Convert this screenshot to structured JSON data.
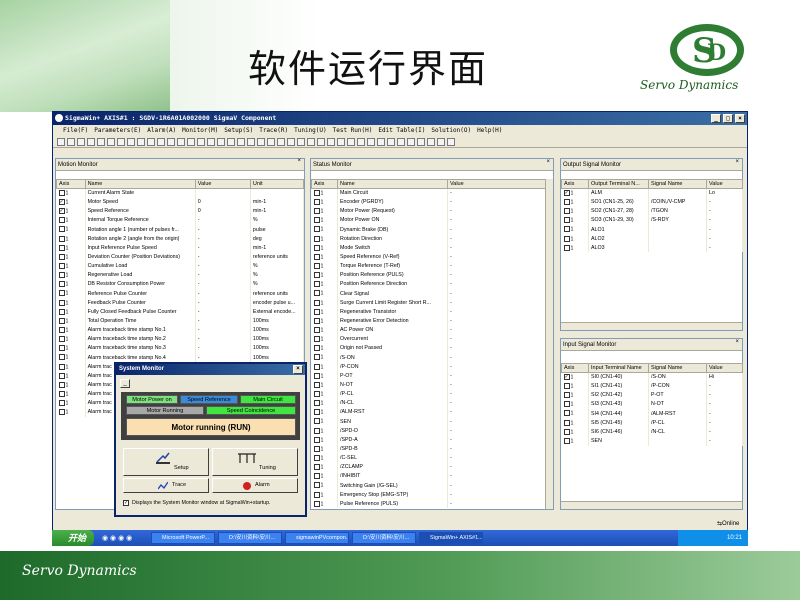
{
  "slide": {
    "title": "软件运行界面",
    "logo_text": "Servo Dynamics",
    "footer_text": "Servo Dynamics",
    "brand_color": "#1d6a2a"
  },
  "window": {
    "title": "SigmaWin+ AXIS#1 : SGDV-1R6A01A002000 SigmaV Component"
  },
  "menu": [
    "File(F)",
    "Parameters(E)",
    "Alarm(A)",
    "Monitor(M)",
    "Setup(S)",
    "Trace(R)",
    "Tuning(U)",
    "Test Run(H)",
    "Edit Table(I)",
    "Solution(O)",
    "Help(H)"
  ],
  "motion_monitor": {
    "title": "Motion Monitor",
    "headers": [
      "Axis",
      "Name",
      "Value",
      "Unit"
    ],
    "rows": [
      {
        "axis": "1",
        "checked": false,
        "name": "Current Alarm State",
        "value": "",
        "unit": ""
      },
      {
        "axis": "1",
        "checked": true,
        "name": "Motor Speed",
        "value": "0",
        "unit": "min-1"
      },
      {
        "axis": "1",
        "checked": true,
        "name": "Speed Reference",
        "value": "0",
        "unit": "min-1"
      },
      {
        "axis": "1",
        "checked": false,
        "name": "Internal Torque Reference",
        "value": "-",
        "unit": "%"
      },
      {
        "axis": "1",
        "checked": false,
        "name": "Rotation angle 1 (number of pulses fr...",
        "value": "-",
        "unit": "pulse"
      },
      {
        "axis": "1",
        "checked": false,
        "name": "Rotation angle 2 (angle from the origin)",
        "value": "-",
        "unit": "deg"
      },
      {
        "axis": "1",
        "checked": false,
        "name": "Input Reference Pulse Speed",
        "value": "-",
        "unit": "min-1"
      },
      {
        "axis": "1",
        "checked": false,
        "name": "Deviation Counter (Position Deviations)",
        "value": "-",
        "unit": "reference units"
      },
      {
        "axis": "1",
        "checked": false,
        "name": "Cumulative Load",
        "value": "-",
        "unit": "%"
      },
      {
        "axis": "1",
        "checked": false,
        "name": "Regenerative Load",
        "value": "-",
        "unit": "%"
      },
      {
        "axis": "1",
        "checked": false,
        "name": "DB Resistor Consumption Power",
        "value": "-",
        "unit": "%"
      },
      {
        "axis": "1",
        "checked": false,
        "name": "Reference Pulse Counter",
        "value": "-",
        "unit": "reference units"
      },
      {
        "axis": "1",
        "checked": false,
        "name": "Feedback Pulse Counter",
        "value": "-",
        "unit": "encoder pulse u..."
      },
      {
        "axis": "1",
        "checked": false,
        "name": "Fully Closed Feedback Pulse Counter",
        "value": "-",
        "unit": "External encode..."
      },
      {
        "axis": "1",
        "checked": false,
        "name": "Total Operation Time",
        "value": "-",
        "unit": "100ms"
      },
      {
        "axis": "1",
        "checked": false,
        "name": "Alarm traceback time stamp No.1",
        "value": "-",
        "unit": "100ms"
      },
      {
        "axis": "1",
        "checked": false,
        "name": "Alarm traceback time stamp No.2",
        "value": "-",
        "unit": "100ms"
      },
      {
        "axis": "1",
        "checked": false,
        "name": "Alarm traceback time stamp No.3",
        "value": "-",
        "unit": "100ms"
      },
      {
        "axis": "1",
        "checked": false,
        "name": "Alarm traceback time stamp No.4",
        "value": "-",
        "unit": "100ms"
      },
      {
        "axis": "1",
        "checked": false,
        "name": "Alarm trac",
        "value": "",
        "unit": ""
      },
      {
        "axis": "1",
        "checked": false,
        "name": "Alarm trac",
        "value": "",
        "unit": ""
      },
      {
        "axis": "1",
        "checked": false,
        "name": "Alarm trac",
        "value": "",
        "unit": ""
      },
      {
        "axis": "1",
        "checked": false,
        "name": "Alarm trac",
        "value": "",
        "unit": ""
      },
      {
        "axis": "1",
        "checked": false,
        "name": "Alarm trac",
        "value": "",
        "unit": ""
      },
      {
        "axis": "1",
        "checked": false,
        "name": "Alarm trac",
        "value": "",
        "unit": ""
      }
    ]
  },
  "status_monitor": {
    "title": "Status Monitor",
    "headers": [
      "Axis",
      "Name",
      "Value"
    ],
    "rows": [
      {
        "axis": "1",
        "name": "Main Circuit",
        "value": "-"
      },
      {
        "axis": "1",
        "name": "Encoder (PGRDY)",
        "value": "-"
      },
      {
        "axis": "1",
        "name": "Motor Power (Request)",
        "value": "-"
      },
      {
        "axis": "1",
        "name": "Motor Power ON",
        "value": "-"
      },
      {
        "axis": "1",
        "name": "Dynamic Brake (DB)",
        "value": "-"
      },
      {
        "axis": "1",
        "name": "Rotation Direction",
        "value": "-"
      },
      {
        "axis": "1",
        "name": "Mode Switch",
        "value": "-"
      },
      {
        "axis": "1",
        "name": "Speed Reference (V-Ref)",
        "value": "-"
      },
      {
        "axis": "1",
        "name": "Torque Reference (T-Ref)",
        "value": "-"
      },
      {
        "axis": "1",
        "name": "Position Reference (PULS)",
        "value": "-"
      },
      {
        "axis": "1",
        "name": "Position Reference Direction",
        "value": "-"
      },
      {
        "axis": "1",
        "name": "Clear Signal",
        "value": "-"
      },
      {
        "axis": "1",
        "name": "Surge Current Limit Register Short R...",
        "value": "-"
      },
      {
        "axis": "1",
        "name": "Regenerative Transistor",
        "value": "-"
      },
      {
        "axis": "1",
        "name": "Regenerative Error Detection",
        "value": "-"
      },
      {
        "axis": "1",
        "name": "AC Power ON",
        "value": "-"
      },
      {
        "axis": "1",
        "name": "Overcurrent",
        "value": "-"
      },
      {
        "axis": "1",
        "name": "Origin not Passed",
        "value": "-"
      },
      {
        "axis": "1",
        "name": "/S-ON",
        "value": "-"
      },
      {
        "axis": "1",
        "name": "/P-CON",
        "value": "-"
      },
      {
        "axis": "1",
        "name": "P-OT",
        "value": "-"
      },
      {
        "axis": "1",
        "name": "N-OT",
        "value": "-"
      },
      {
        "axis": "1",
        "name": "/P-CL",
        "value": "-"
      },
      {
        "axis": "1",
        "name": "/N-CL",
        "value": "-"
      },
      {
        "axis": "1",
        "name": "/ALM-RST",
        "value": "-"
      },
      {
        "axis": "1",
        "name": "SEN",
        "value": "-"
      },
      {
        "axis": "1",
        "name": "/SPD-D",
        "value": "-"
      },
      {
        "axis": "1",
        "name": "/SPD-A",
        "value": "-"
      },
      {
        "axis": "1",
        "name": "/SPD-B",
        "value": "-"
      },
      {
        "axis": "1",
        "name": "/C-SEL",
        "value": "-"
      },
      {
        "axis": "1",
        "name": "/ZCLAMP",
        "value": "-"
      },
      {
        "axis": "1",
        "name": "/INHIBIT",
        "value": "-"
      },
      {
        "axis": "1",
        "name": "Switching Gain (/G-SEL)",
        "value": "-"
      },
      {
        "axis": "1",
        "name": "Emergency Stop (EMG-STP)",
        "value": "-"
      },
      {
        "axis": "1",
        "name": "Pulse Reference (PULS)",
        "value": "-"
      }
    ]
  },
  "output_monitor": {
    "title": "Output Signal Monitor",
    "headers": [
      "Axis",
      "Output Terminal N...",
      "Signal Name",
      "Value"
    ],
    "rows": [
      {
        "axis": "1",
        "checked": true,
        "terminal": "ALM",
        "signal": "",
        "value": "Lo"
      },
      {
        "axis": "1",
        "checked": false,
        "terminal": "SO1 (CN1-25, 26)",
        "signal": "/COIN,/V-CMP",
        "value": "-"
      },
      {
        "axis": "1",
        "checked": false,
        "terminal": "SO2 (CN1-27, 28)",
        "signal": "/TGON",
        "value": "-"
      },
      {
        "axis": "1",
        "checked": false,
        "terminal": "SO3 (CN1-29, 30)",
        "signal": "/S-RDY",
        "value": "-"
      },
      {
        "axis": "1",
        "checked": false,
        "terminal": "ALO1",
        "signal": "",
        "value": "-"
      },
      {
        "axis": "1",
        "checked": false,
        "terminal": "ALO2",
        "signal": "",
        "value": "-"
      },
      {
        "axis": "1",
        "checked": false,
        "terminal": "ALO3",
        "signal": "",
        "value": "-"
      }
    ]
  },
  "input_monitor": {
    "title": "Input Signal Monitor",
    "headers": [
      "Axis",
      "Input Terminal Name",
      "Signal Name",
      "Value"
    ],
    "rows": [
      {
        "axis": "1",
        "checked": true,
        "terminal": "SI0 (CN1-40)",
        "signal": "/S-ON",
        "value": "Hi"
      },
      {
        "axis": "1",
        "checked": false,
        "terminal": "SI1 (CN1-41)",
        "signal": "/P-CON",
        "value": "-"
      },
      {
        "axis": "1",
        "checked": false,
        "terminal": "SI2 (CN1-42)",
        "signal": "P-OT",
        "value": "-"
      },
      {
        "axis": "1",
        "checked": false,
        "terminal": "SI3 (CN1-43)",
        "signal": "N-OT",
        "value": "-"
      },
      {
        "axis": "1",
        "checked": false,
        "terminal": "SI4 (CN1-44)",
        "signal": "/ALM-RST",
        "value": "-"
      },
      {
        "axis": "1",
        "checked": false,
        "terminal": "SI5 (CN1-45)",
        "signal": "/P-CL",
        "value": "-"
      },
      {
        "axis": "1",
        "checked": false,
        "terminal": "SI6 (CN1-46)",
        "signal": "/N-CL",
        "value": "-"
      },
      {
        "axis": "1",
        "checked": false,
        "terminal": "SEN",
        "signal": "",
        "value": "-"
      }
    ]
  },
  "system_monitor": {
    "title": "System Monitor",
    "indicators": [
      {
        "label": "Motor Power on",
        "color": "#7fe07f"
      },
      {
        "label": "Speed Reference",
        "color": "#3c8bd9"
      },
      {
        "label": "Main Circuit",
        "color": "#3fe63f"
      },
      {
        "label": "Motor Running",
        "color": "#a8a8a8"
      },
      {
        "label": "Speed Coincidence",
        "color": "#3fe63f"
      }
    ],
    "status": "Motor running (RUN)",
    "status_color": "#fadfb0",
    "buttons": {
      "setup": "Setup",
      "tuning": "Tuning",
      "trace": "Trace",
      "alarm": "Alarm"
    },
    "startup_label": "Displays the System Monitor window at SigmaWin+startup.",
    "startup_checked": true
  },
  "taskbar": {
    "start": "开始",
    "tasks": [
      "Microsoft PowerP...",
      "D:\\安川资料\\安川...",
      "sigmawinPVcompon...",
      "D:\\安川资料\\安川...",
      "SigmaWin+ AXIS#1..."
    ],
    "clock": "10:21",
    "online": "Online"
  }
}
